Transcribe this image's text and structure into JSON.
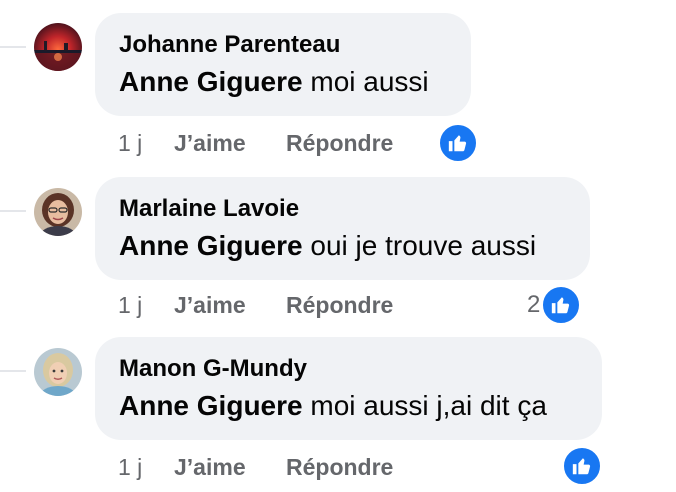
{
  "comments": [
    {
      "author": "Johanne Parenteau",
      "mention": "Anne Giguere",
      "text": " moi aussi",
      "time": "1 j",
      "like_label": "J’aime",
      "reply_label": "Répondre",
      "reaction_count": "",
      "reaction_icon": "thumbs-up-icon"
    },
    {
      "author": "Marlaine Lavoie",
      "mention": "Anne Giguere",
      "text": " oui je trouve aussi",
      "time": "1 j",
      "like_label": "J’aime",
      "reply_label": "Répondre",
      "reaction_count": "2",
      "reaction_icon": "thumbs-up-icon"
    },
    {
      "author": "Manon G-Mundy",
      "mention": "Anne Giguere",
      "text": " moi aussi j,ai dit ça",
      "time": "1 j",
      "like_label": "J’aime",
      "reply_label": "Répondre",
      "reaction_count": "",
      "reaction_icon": "thumbs-up-icon"
    }
  ],
  "colors": {
    "bubble": "#f0f2f5",
    "text": "#050505",
    "secondary": "#65676b",
    "like_blue": "#1877f2"
  }
}
